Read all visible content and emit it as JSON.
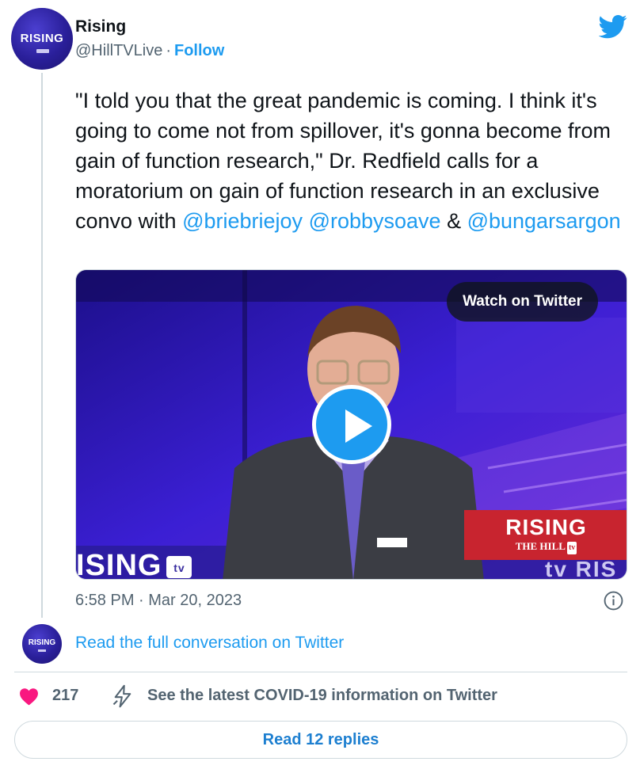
{
  "account": {
    "name": "Rising",
    "handle": "@HillTVLive",
    "separator": "·",
    "follow_label": "Follow",
    "avatar_text": "RISING"
  },
  "icons": {
    "brand": "twitter-bird-icon",
    "play": "play-icon",
    "info": "info-icon",
    "like": "heart-icon",
    "covid": "lightning-bolt-icon"
  },
  "tweet": {
    "text_before": "\"I told you that the great pandemic is coming. I think it's going to come not from spillover, it's gonna become from gain of function research,\" Dr. Redfield calls for a moratorium on gain of function research in an exclusive convo with ",
    "mention_1": "@briebriejoy",
    "mention_2": "@robbysoave",
    "ampersand": " & ",
    "mention_3": "@bungarsargon",
    "timestamp": "6:58 PM · Mar 20, 2023"
  },
  "media": {
    "watch_label": "Watch on Twitter",
    "bug_title": "RISING",
    "bug_subtitle": "THE HILL",
    "bug_tv": "tv",
    "lower_third_text": "ISING",
    "lower_third_tv": "tv",
    "lower_right_text": "tv RIS"
  },
  "conversation": {
    "avatar_text": "RISING",
    "read_full_label": "Read the full conversation on Twitter"
  },
  "actions": {
    "like_count": "217",
    "covid_label": "See the latest COVID-19 information on Twitter",
    "replies_label": "Read 12 replies"
  },
  "colors": {
    "accent": "#1d9bf0",
    "heart": "#f91880",
    "secondary_text": "#536471",
    "rising_red": "#c8242f",
    "avatar_purple": "#2a1f9a"
  }
}
